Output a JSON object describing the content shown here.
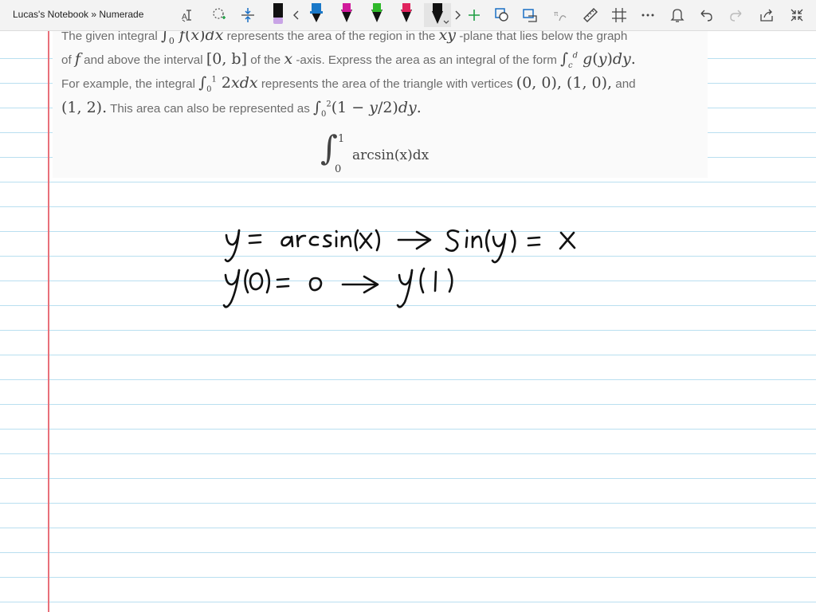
{
  "app": {
    "title": "Lucas's Notebook » Numerade"
  },
  "toolbar": {
    "items": [
      "text-to-drawing-icon",
      "lasso-select-icon",
      "insert-space-icon",
      "pen-black-icon",
      "scroll-left-icon",
      "pen-blue-icon",
      "pen-magenta-icon",
      "pen-green-icon",
      "pen-red-icon",
      "pen-black-selected-icon",
      "scroll-right-icon",
      "add-pen-icon",
      "shapes-icon",
      "ink-to-shape-icon",
      "ink-to-math-icon",
      "ruler-icon",
      "grid-icon",
      "more-icon",
      "bell-icon",
      "undo-icon",
      "redo-icon",
      "share-icon",
      "fullscreen-icon"
    ]
  },
  "problem": {
    "l1_a": "The given integral ",
    "l1_b": " represents the area of the region in the ",
    "l1_xy": "xy",
    "l1_c": " -plane that lies below the graph",
    "l2_a": "of ",
    "l2_f": "f",
    "l2_b": " and above the interval ",
    "l2_interval": "[0, b]",
    "l2_c": " of the ",
    "l2_x": "x",
    "l2_d": " -axis. Express the area as an integral of the form ",
    "l3_a": "For example, the integral ",
    "l3_b": " represents the area of the triangle with vertices ",
    "l3_v1": "(0, 0), (1, 0),",
    "l3_c": " and",
    "l4_v3": "(1, 2).",
    "l4_a": " This area can also be represented as ",
    "display_integrand": "arcsin(x)dx",
    "display_upper": "1",
    "display_lower": "0"
  },
  "handwriting": {
    "line1": "y = arcsin(x) → sin(y) = x",
    "line2": "y(0) = 0 → y(1)"
  },
  "colors": {
    "margin_line": "#e8707a",
    "rule_line": "#b9dff0",
    "ink": "#111111",
    "accent_green": "#1e9e43"
  }
}
